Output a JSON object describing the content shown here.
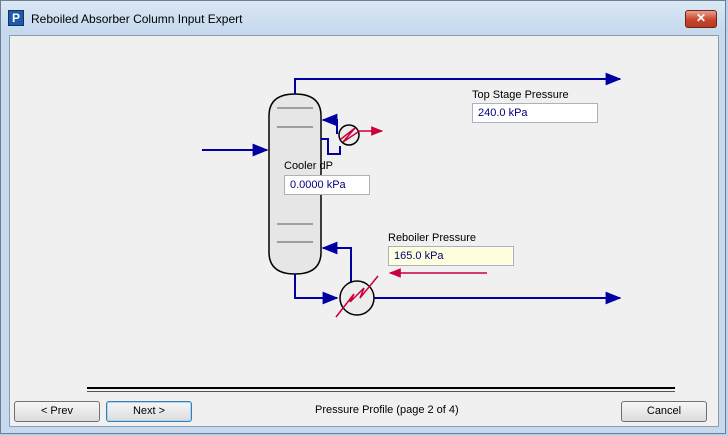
{
  "window": {
    "title": "Reboiled Absorber Column Input Expert",
    "app_icon_glyph": "P",
    "close_glyph": "✕"
  },
  "fields": {
    "top_stage_pressure": {
      "label": "Top Stage Pressure",
      "value": "240.0 kPa"
    },
    "cooler_dp": {
      "label": "Cooler dP",
      "value": "0.0000 kPa"
    },
    "reboiler_pressure": {
      "label": "Reboiler Pressure",
      "value": "165.0 kPa"
    }
  },
  "footer": {
    "prev_label": "< Prev",
    "next_label": "Next >",
    "status": "Pressure Profile (page 2 of 4)",
    "cancel_label": "Cancel"
  },
  "colors": {
    "stream": "#0000a0",
    "energy": "#c8003c",
    "field_active_bg": "#ffffdf"
  },
  "icons": [
    "app-icon",
    "close-icon",
    "column-icon",
    "condenser-icon",
    "reboiler-icon"
  ]
}
